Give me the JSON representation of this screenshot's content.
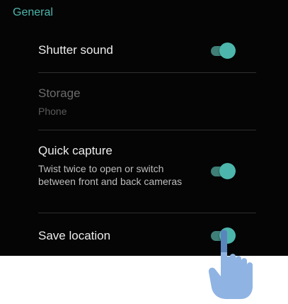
{
  "section": {
    "title": "General"
  },
  "settings": [
    {
      "title": "Shutter sound",
      "summary": "",
      "enabled": true,
      "checked": true
    },
    {
      "title": "Storage",
      "summary": "Phone",
      "enabled": false
    },
    {
      "title": "Quick capture",
      "summary": "Twist twice to open or switch between front and back cameras",
      "enabled": true,
      "checked": true
    },
    {
      "title": "Save location",
      "summary": "",
      "enabled": true,
      "checked": true
    }
  ],
  "colors": {
    "accent": "#4db6ac",
    "background": "#050505",
    "hand": "#8fb4e3"
  },
  "icons": {
    "pointer": "tap-hand-icon"
  }
}
